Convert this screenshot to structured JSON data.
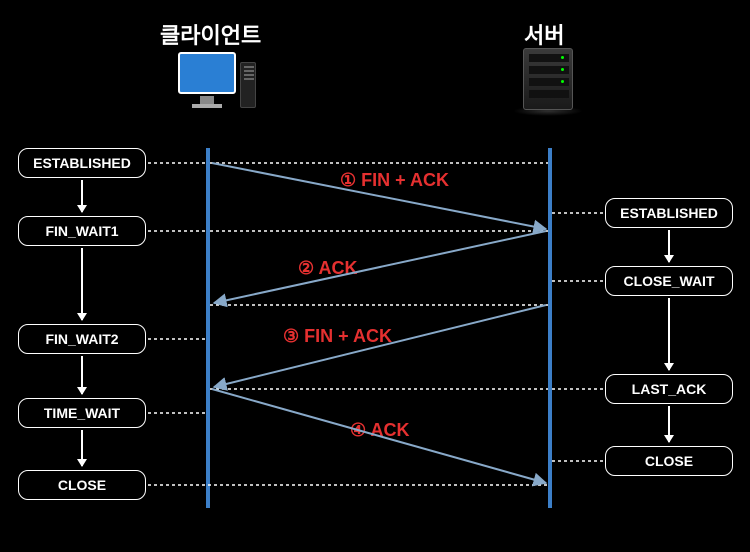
{
  "headers": {
    "client": "클라이언트",
    "server": "서버"
  },
  "client_states": [
    "ESTABLISHED",
    "FIN_WAIT1",
    "FIN_WAIT2",
    "TIME_WAIT",
    "CLOSE"
  ],
  "server_states": [
    "ESTABLISHED",
    "CLOSE_WAIT",
    "LAST_ACK",
    "CLOSE"
  ],
  "messages": [
    "① FIN + ACK",
    "② ACK",
    "③ FIN + ACK",
    "④ ACK"
  ],
  "colors": {
    "background": "#000000",
    "box_border": "#ffffff",
    "timeline": "#3c7fc8",
    "message_text": "#e53030",
    "arrow_stroke": "#88a9c9"
  }
}
